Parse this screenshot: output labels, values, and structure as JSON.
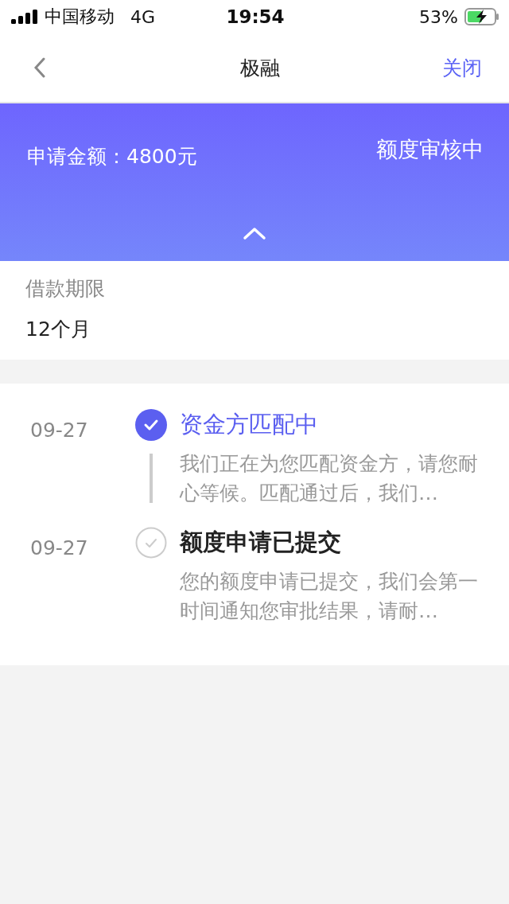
{
  "status_bar": {
    "carrier": "中国移动",
    "network": "4G",
    "time": "19:54",
    "battery": "53%"
  },
  "nav": {
    "title": "极融",
    "close": "关闭"
  },
  "banner": {
    "amount": "申请金额：4800元",
    "status": "额度审核中"
  },
  "term": {
    "label": "借款期限",
    "value": "12个月"
  },
  "timeline": [
    {
      "date": "09-27",
      "title": "资金方匹配中",
      "description": "我们正在为您匹配资金方，请您耐心等候。匹配通过后，我们…",
      "active": true
    },
    {
      "date": "09-27",
      "title": "额度申请已提交",
      "description": "您的额度申请已提交，我们会第一时间通知您审批结果，请耐…",
      "active": false
    }
  ]
}
